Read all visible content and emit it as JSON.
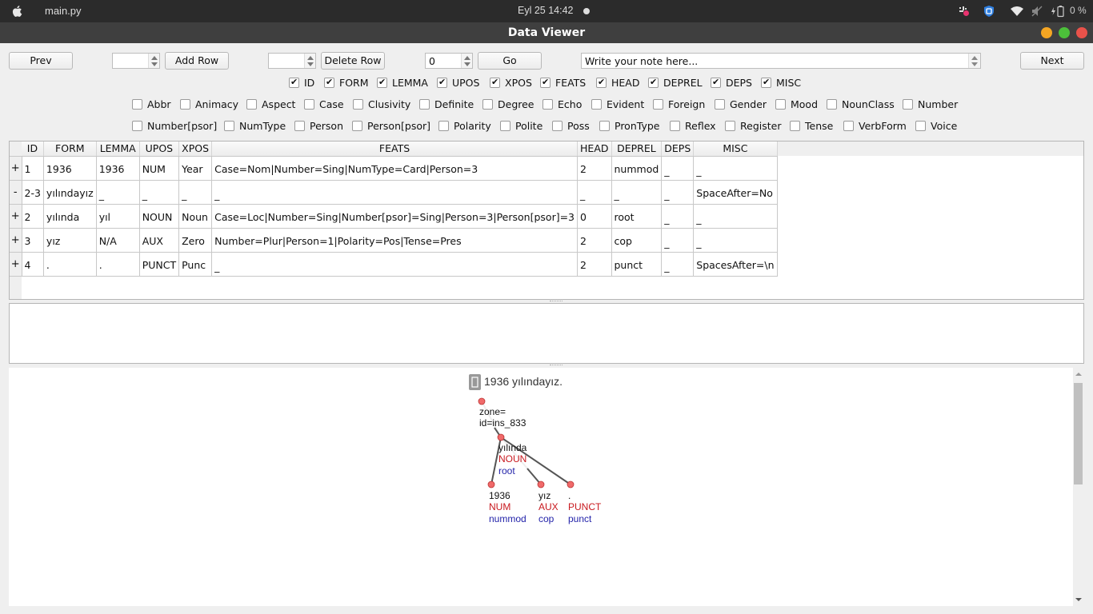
{
  "system_bar": {
    "app_name": "main.py",
    "clock": "Eyl 25  14:42",
    "battery_text": "0 %",
    "icons": [
      "apple-icon",
      "slack-icon",
      "vpn-shield-icon",
      "wifi-icon",
      "volume-muted-icon",
      "battery-charging-icon"
    ]
  },
  "window": {
    "title": "Data Viewer",
    "controls": {
      "minimize_color": "#f5a623",
      "maximize_color": "#4cc03a",
      "close_color": "#e9524a"
    }
  },
  "toolbar": {
    "prev_label": "Prev",
    "add_row_spin_value": "",
    "add_row_label": "Add Row",
    "delete_row_spin_value": "",
    "delete_row_label": "Delete Row",
    "go_spin_value": "0",
    "go_label": "Go",
    "note_value": "Write your note here...",
    "next_label": "Next"
  },
  "column_toggles": [
    {
      "label": "ID",
      "checked": true
    },
    {
      "label": "FORM",
      "checked": true
    },
    {
      "label": "LEMMA",
      "checked": true
    },
    {
      "label": "UPOS",
      "checked": true
    },
    {
      "label": "XPOS",
      "checked": true
    },
    {
      "label": "FEATS",
      "checked": true
    },
    {
      "label": "HEAD",
      "checked": true
    },
    {
      "label": "DEPREL",
      "checked": true
    },
    {
      "label": "DEPS",
      "checked": true
    },
    {
      "label": "MISC",
      "checked": true
    }
  ],
  "feature_toggles_row1": [
    {
      "label": "Abbr",
      "checked": false
    },
    {
      "label": "Animacy",
      "checked": false
    },
    {
      "label": "Aspect",
      "checked": false
    },
    {
      "label": "Case",
      "checked": false
    },
    {
      "label": "Clusivity",
      "checked": false
    },
    {
      "label": "Definite",
      "checked": false
    },
    {
      "label": "Degree",
      "checked": false
    },
    {
      "label": "Echo",
      "checked": false
    },
    {
      "label": "Evident",
      "checked": false
    },
    {
      "label": "Foreign",
      "checked": false
    },
    {
      "label": "Gender",
      "checked": false
    },
    {
      "label": "Mood",
      "checked": false
    },
    {
      "label": "NounClass",
      "checked": false
    },
    {
      "label": "Number",
      "checked": false
    }
  ],
  "feature_toggles_row2": [
    {
      "label": "Number[psor]",
      "checked": false
    },
    {
      "label": "NumType",
      "checked": false
    },
    {
      "label": "Person",
      "checked": false
    },
    {
      "label": "Person[psor]",
      "checked": false
    },
    {
      "label": "Polarity",
      "checked": false
    },
    {
      "label": "Polite",
      "checked": false
    },
    {
      "label": "Poss",
      "checked": false
    },
    {
      "label": "PronType",
      "checked": false
    },
    {
      "label": "Reflex",
      "checked": false
    },
    {
      "label": "Register",
      "checked": false
    },
    {
      "label": "Tense",
      "checked": false
    },
    {
      "label": "VerbForm",
      "checked": false
    },
    {
      "label": "Voice",
      "checked": false
    }
  ],
  "table": {
    "columns": [
      "ID",
      "FORM",
      "LEMMA",
      "UPOS",
      "XPOS",
      "FEATS",
      "HEAD",
      "DEPREL",
      "DEPS",
      "MISC"
    ],
    "rows": [
      {
        "toggle": "+",
        "cells": [
          "1",
          "1936",
          "1936",
          "NUM",
          "Year",
          "Case=Nom|Number=Sing|NumType=Card|Person=3",
          "2",
          "nummod",
          "_",
          "_"
        ]
      },
      {
        "toggle": "-",
        "cells": [
          "2-3",
          "yılındayız",
          "_",
          "_",
          "_",
          "_",
          "_",
          "_",
          "_",
          "SpaceAfter=No"
        ]
      },
      {
        "toggle": "+",
        "cells": [
          "2",
          "yılında",
          "yıl",
          "NOUN",
          "Noun",
          "Case=Loc|Number=Sing|Number[psor]=Sing|Person=3|Person[psor]=3",
          "0",
          "root",
          "_",
          "_"
        ]
      },
      {
        "toggle": "+",
        "cells": [
          "3",
          "yız",
          "N/A",
          "AUX",
          "Zero",
          "Number=Plur|Person=1|Polarity=Pos|Tense=Pres",
          "2",
          "cop",
          "_",
          "_"
        ]
      },
      {
        "toggle": "+",
        "cells": [
          "4",
          ".",
          ".",
          "PUNCT",
          "Punc",
          "_",
          "2",
          "punct",
          "_",
          "SpacesAfter=\\n"
        ]
      }
    ]
  },
  "tree": {
    "sentence": "1936 yılındayız.",
    "root_label_1": "zone=",
    "root_label_2": "id=ins_833",
    "colors": {
      "node": "#f06a6a",
      "upos": "#c8181e",
      "deprel": "#1f1fa8",
      "edge": "#555555"
    },
    "nodes": [
      {
        "form": "yılında",
        "upos": "NOUN",
        "deprel": "root"
      },
      {
        "form": "1936",
        "upos": "NUM",
        "deprel": "nummod"
      },
      {
        "form": "yız",
        "upos": "AUX",
        "deprel": "cop"
      },
      {
        "form": ".",
        "upos": "PUNCT",
        "deprel": "punct"
      }
    ]
  }
}
